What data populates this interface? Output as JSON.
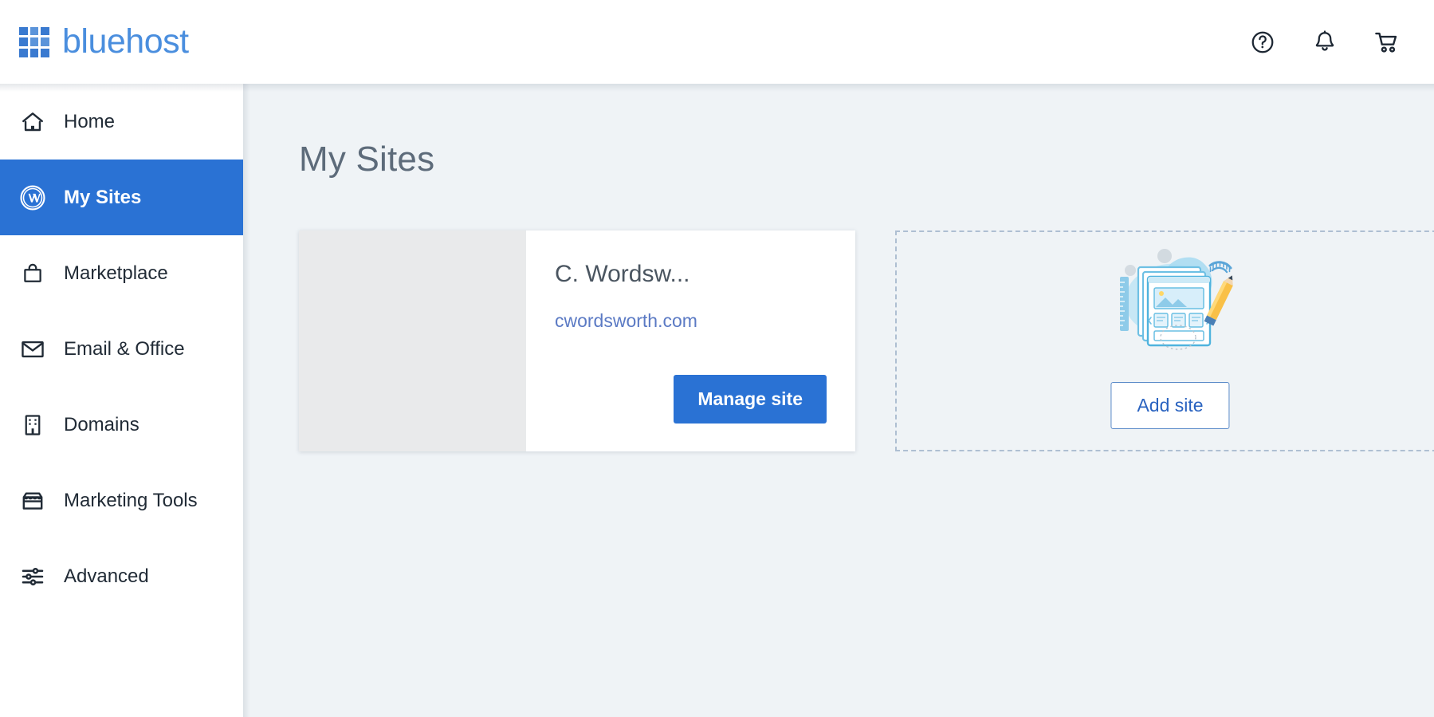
{
  "header": {
    "brand_name": "bluehost",
    "logo_icon": "bluehost-grid-logo",
    "actions": [
      {
        "name": "help-icon",
        "label": "Help"
      },
      {
        "name": "notifications-bell-icon",
        "label": "Notifications"
      },
      {
        "name": "shopping-cart-icon",
        "label": "Cart"
      }
    ]
  },
  "sidebar": {
    "items": [
      {
        "label": "Home",
        "icon": "home-icon",
        "active": false
      },
      {
        "label": "My Sites",
        "icon": "wordpress-icon",
        "active": true
      },
      {
        "label": "Marketplace",
        "icon": "shopping-bag-icon",
        "active": false
      },
      {
        "label": "Email & Office",
        "icon": "envelope-icon",
        "active": false
      },
      {
        "label": "Domains",
        "icon": "building-icon",
        "active": false
      },
      {
        "label": "Marketing Tools",
        "icon": "storefront-icon",
        "active": false
      },
      {
        "label": "Advanced",
        "icon": "sliders-icon",
        "active": false
      }
    ]
  },
  "main": {
    "page_title": "My Sites",
    "site_card": {
      "site_name": "C. Wordsw...",
      "domain": "cwordsworth.com",
      "manage_label": "Manage site",
      "thumbnail_state": "empty-placeholder"
    },
    "add_panel": {
      "add_label": "Add site",
      "illustration": "website-builder-illustration"
    }
  },
  "colors": {
    "accent_blue": "#2a72d4",
    "brand_blue": "#4a8ede",
    "link_blue": "#5b7ac4",
    "page_background": "#eff3f6",
    "sidebar_background": "#ffffff",
    "title_gray": "#5d6b7a",
    "thumbnail_gray": "#e9eaeb",
    "dashed_border": "#aebfd2"
  }
}
